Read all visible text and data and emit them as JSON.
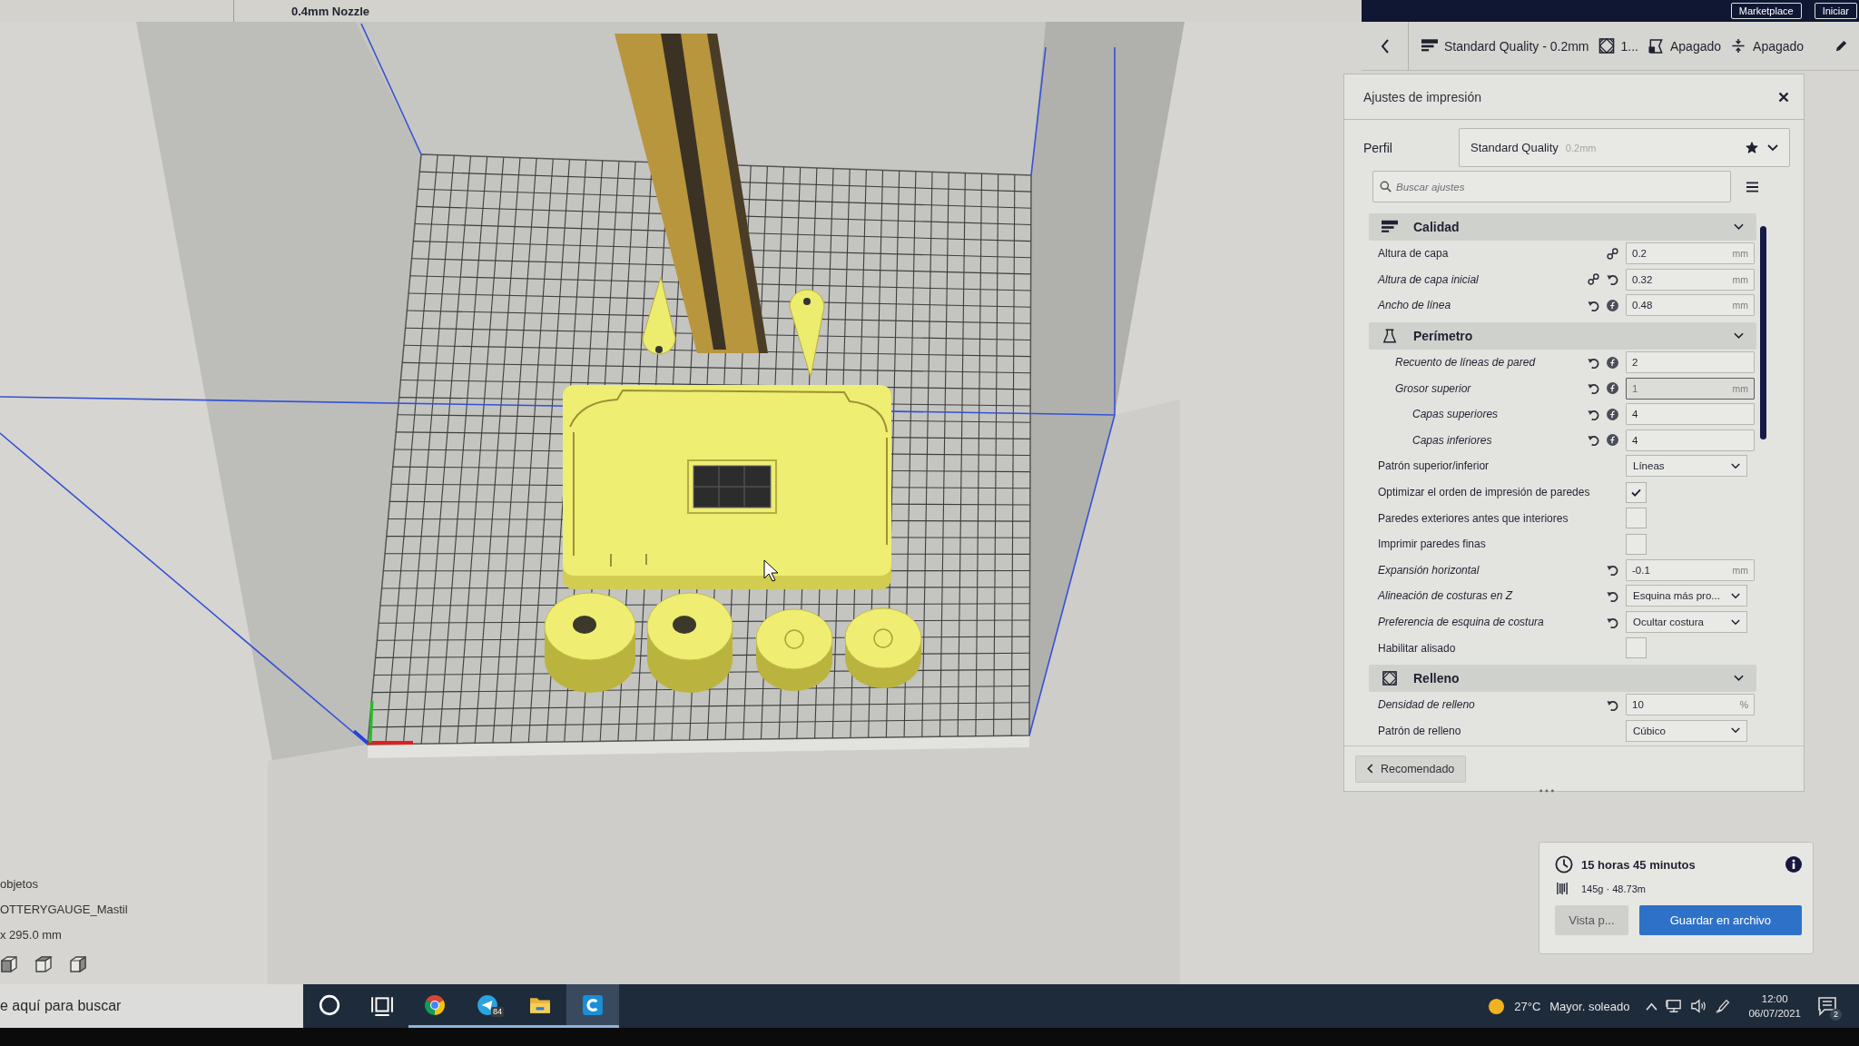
{
  "header": {
    "printer_nozzle": "0.4mm Nozzle",
    "buttons": [
      "Marketplace",
      "Iniciar"
    ]
  },
  "stage_bar": {
    "items": [
      {
        "kind": "quality",
        "text": "Standard Quality - 0.2mm"
      },
      {
        "kind": "infill",
        "text": "1..."
      },
      {
        "kind": "support",
        "text": "Apagado"
      },
      {
        "kind": "adhesion",
        "text": "Apagado"
      }
    ]
  },
  "settings_panel": {
    "title": "Ajustes de impresión",
    "profile": {
      "label": "Perfil",
      "value": "Standard Quality",
      "detail": "0.2mm",
      "favorite": true
    },
    "search": {
      "placeholder": "Buscar ajustes"
    },
    "sections": [
      {
        "kind": "quality",
        "title": "Calidad",
        "expanded": true,
        "rows": [
          {
            "label": "Altura de capa",
            "italic": false,
            "icons": [
              {
                "kind": "link"
              }
            ],
            "kind": "number",
            "value": "0.2",
            "unit": "mm",
            "hovered": false
          },
          {
            "label": "Altura de capa inicial",
            "italic": true,
            "icons": [
              {
                "kind": "link"
              },
              {
                "kind": "reset"
              }
            ],
            "kind": "number",
            "value": "0.32",
            "unit": "mm",
            "hovered": false
          },
          {
            "label": "Ancho de línea",
            "italic": true,
            "icons": [
              {
                "kind": "reset"
              },
              {
                "kind": "function"
              }
            ],
            "kind": "number",
            "value": "0.48",
            "unit": "mm",
            "hovered": false
          }
        ]
      },
      {
        "kind": "walls",
        "title": "Perímetro",
        "expanded": true,
        "rows": [
          {
            "children": [
              {
                "label": "Recuento de líneas de pared",
                "italic": true,
                "icons": [
                  {
                    "kind": "reset"
                  },
                  {
                    "kind": "function"
                  }
                ],
                "kind": "number",
                "value": "2",
                "hovered": false
              },
              {
                "label": "Grosor superior",
                "italic": true,
                "icons": [
                  {
                    "kind": "reset"
                  },
                  {
                    "kind": "function"
                  }
                ],
                "kind": "number",
                "value": "1",
                "unit": "mm",
                "hovered": true
              },
              {
                "children": [
                  {
                    "label": "Capas superiores",
                    "italic": true,
                    "icons": [
                      {
                        "kind": "reset"
                      },
                      {
                        "kind": "function"
                      }
                    ],
                    "kind": "number",
                    "value": "4",
                    "hovered": false
                  },
                  {
                    "label": "Capas inferiores",
                    "italic": true,
                    "icons": [
                      {
                        "kind": "reset"
                      },
                      {
                        "kind": "function"
                      }
                    ],
                    "kind": "number",
                    "value": "4",
                    "hovered": false
                  }
                ]
              }
            ]
          },
          {
            "label": "Patrón superior/inferior",
            "italic": false,
            "kind": "select",
            "value": "Líneas"
          },
          {
            "label": "Optimizar el orden de impresión de paredes",
            "italic": false,
            "kind": "checkbox",
            "checked": true
          },
          {
            "label": "Paredes exteriores antes que interiores",
            "italic": false,
            "kind": "checkbox",
            "checked": false
          },
          {
            "label": "Imprimir paredes finas",
            "italic": false,
            "kind": "checkbox",
            "checked": false
          },
          {
            "label": "Expansión horizontal",
            "italic": true,
            "icons": [
              {
                "kind": "reset"
              }
            ],
            "kind": "number",
            "value": "-0.1",
            "unit": "mm",
            "hovered": false
          },
          {
            "label": "Alineación de costuras en Z",
            "italic": true,
            "icons": [
              {
                "kind": "reset"
              }
            ],
            "kind": "select",
            "value": "Esquina más pro..."
          },
          {
            "label": "Preferencia de esquina de costura",
            "italic": true,
            "icons": [
              {
                "kind": "reset"
              }
            ],
            "kind": "select",
            "value": "Ocultar costura"
          },
          {
            "label": "Habilitar alisado",
            "italic": false,
            "kind": "checkbox",
            "checked": false
          }
        ]
      },
      {
        "kind": "infill",
        "title": "Relleno",
        "expanded": true,
        "rows": [
          {
            "label": "Densidad de relleno",
            "italic": true,
            "icons": [
              {
                "kind": "reset"
              }
            ],
            "kind": "number",
            "value": "10",
            "unit": "%",
            "hovered": false
          },
          {
            "label": "Patrón de relleno",
            "italic": false,
            "kind": "select",
            "value": "Cúbico"
          }
        ]
      }
    ],
    "footer_button": "Recomendado"
  },
  "object_list": {
    "title": "objetos",
    "object_name": "OTTERYGAUGE_Mastil",
    "dimensions": "x 295.0 mm"
  },
  "print_summary": {
    "time": "15 horas 45 minutos",
    "material": "145g · 48.73m",
    "buttons": [
      {
        "kind": "secondary",
        "label": "Vista p..."
      },
      {
        "kind": "primary",
        "label": "Guardar en archivo"
      }
    ]
  },
  "taskbar": {
    "search": {
      "placeholder": "e aquí para buscar"
    },
    "apps": [
      {
        "kind": "cortana",
        "running": false,
        "selected": false
      },
      {
        "kind": "task_view",
        "running": false,
        "selected": false
      },
      {
        "kind": "browser",
        "running": true,
        "selected": false
      },
      {
        "kind": "messenger",
        "running": true,
        "selected": false,
        "badge": "84"
      },
      {
        "kind": "files",
        "running": true,
        "selected": false
      },
      {
        "kind": "slicer",
        "running": true,
        "selected": true
      }
    ],
    "weather": {
      "temperature": "27°C",
      "condition": "Mayor. soleado"
    },
    "clock": {
      "time": "12:00",
      "date": "06/07/2021"
    },
    "notifications": {
      "count": "2"
    }
  }
}
